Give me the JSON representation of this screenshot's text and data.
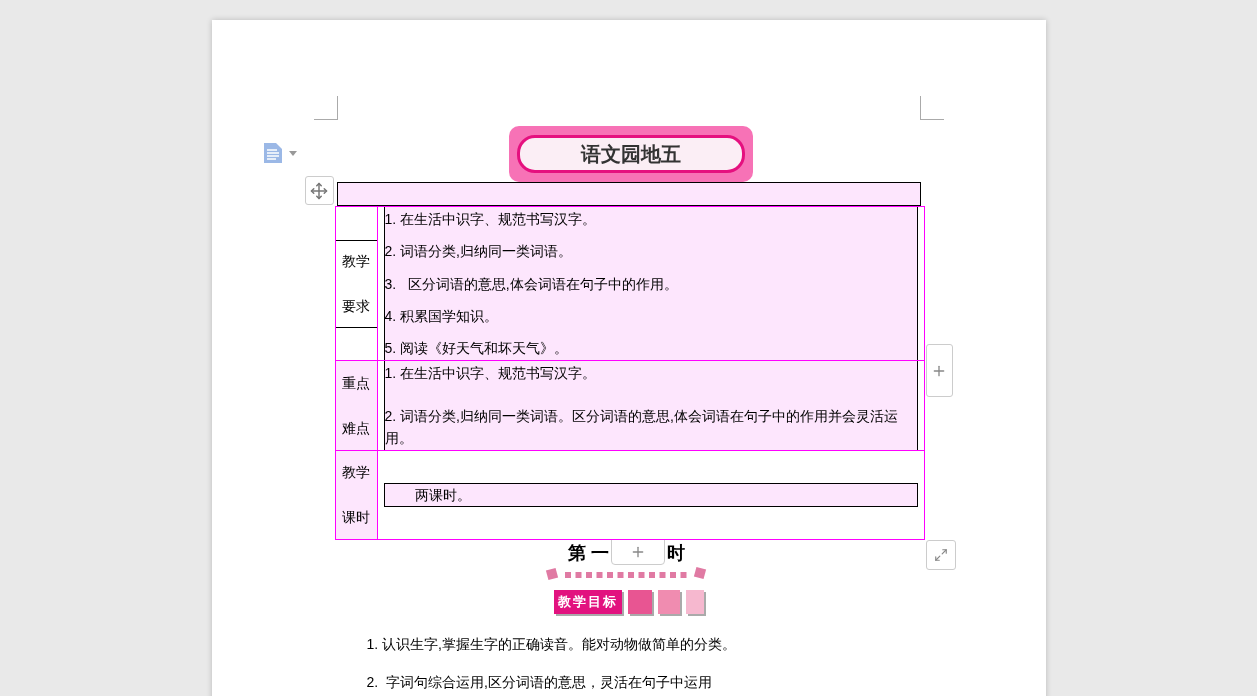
{
  "banner": {
    "title": "语文园地五"
  },
  "table": {
    "rows": [
      {
        "kind": "list",
        "label_lines": [
          "教学",
          "要求"
        ],
        "items": [
          "1. 在生活中识字、规范书写汉字。",
          "2. 词语分类,归纳同一类词语。",
          "3.   区分词语的意思,体会词语在句子中的作用。",
          "4. 积累国学知识。",
          "5. 阅读《好天气和坏天气》。"
        ]
      },
      {
        "kind": "list",
        "label_lines": [
          "重点",
          "难点"
        ],
        "items": [
          "1. 在生活中识字、规范书写汉字。",
          "2. 词语分类,归纳同一类词语。区分词语的意思,体会词语在句子中的作用并会灵活运用。"
        ]
      },
      {
        "kind": "boxed",
        "label_lines": [
          "教学",
          "课时"
        ],
        "items": [
          "两课时。"
        ]
      }
    ]
  },
  "lesson": {
    "heading_parts": [
      "第 一",
      "时"
    ],
    "section_badge": "教学目标",
    "items": [
      "1. 认识生字,掌握生字的正确读音。能对动物做简单的分类。",
      "2.  字词句综合运用,区分词语的意思，灵活在句子中运用"
    ]
  }
}
